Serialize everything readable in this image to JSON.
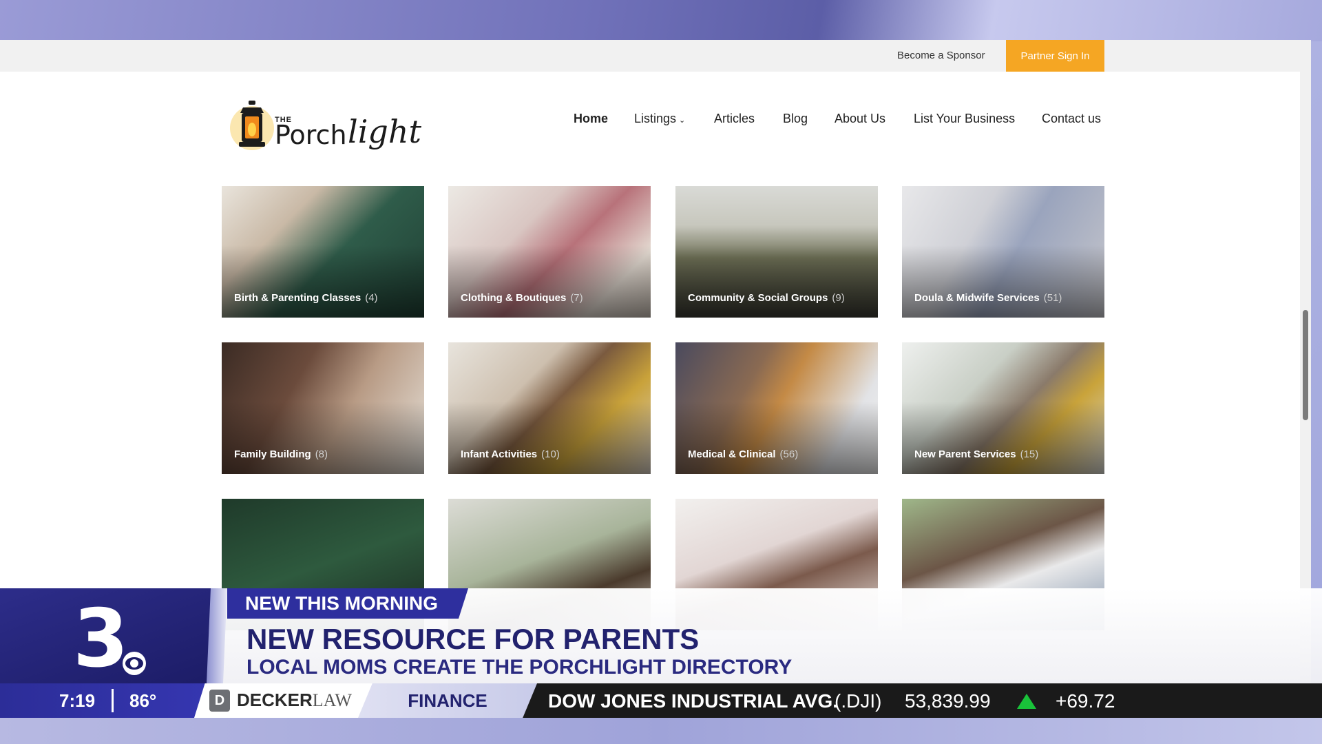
{
  "topbar": {
    "sponsor_label": "Become a Sponsor",
    "partner_label": "Partner Sign In"
  },
  "logo": {
    "the": "THE",
    "porch": "Porch",
    "light": "light"
  },
  "nav": {
    "items": [
      {
        "label": "Home",
        "active": true
      },
      {
        "label": "Listings",
        "dropdown": true
      },
      {
        "label": "Articles"
      },
      {
        "label": "Blog"
      },
      {
        "label": "About Us"
      },
      {
        "label": "List Your Business"
      },
      {
        "label": "Contact us"
      }
    ]
  },
  "categories": [
    {
      "label": "Birth & Parenting Classes",
      "count": "(4)"
    },
    {
      "label": "Clothing & Boutiques",
      "count": "(7)"
    },
    {
      "label": "Community & Social Groups",
      "count": "(9)"
    },
    {
      "label": "Doula & Midwife Services",
      "count": "(51)"
    },
    {
      "label": "Family Building",
      "count": "(8)"
    },
    {
      "label": "Infant Activities",
      "count": "(10)"
    },
    {
      "label": "Medical & Clinical",
      "count": "(56)"
    },
    {
      "label": "New Parent Services",
      "count": "(15)"
    },
    {
      "label": "",
      "count": ""
    },
    {
      "label": "",
      "count": ""
    },
    {
      "label": "",
      "count": ""
    },
    {
      "label": "",
      "count": ""
    }
  ],
  "news": {
    "channel": "3",
    "tag": "NEW THIS MORNING",
    "headline": "NEW RESOURCE FOR PARENTS",
    "subhead": "LOCAL MOMS CREATE THE PORCHLIGHT DIRECTORY",
    "time": "7:19",
    "temp": "86°",
    "sponsor_icon": "D",
    "sponsor_bold": "DECKER",
    "sponsor_thin": "LAW",
    "ticker_category": "FINANCE",
    "ticker_name": "DOW JONES INDUSTRIAL AVG.",
    "ticker_symbol": "(.DJI)",
    "ticker_value": "53,839.99",
    "ticker_change": "+69.72",
    "ticker_direction_color": "#19c23a"
  }
}
